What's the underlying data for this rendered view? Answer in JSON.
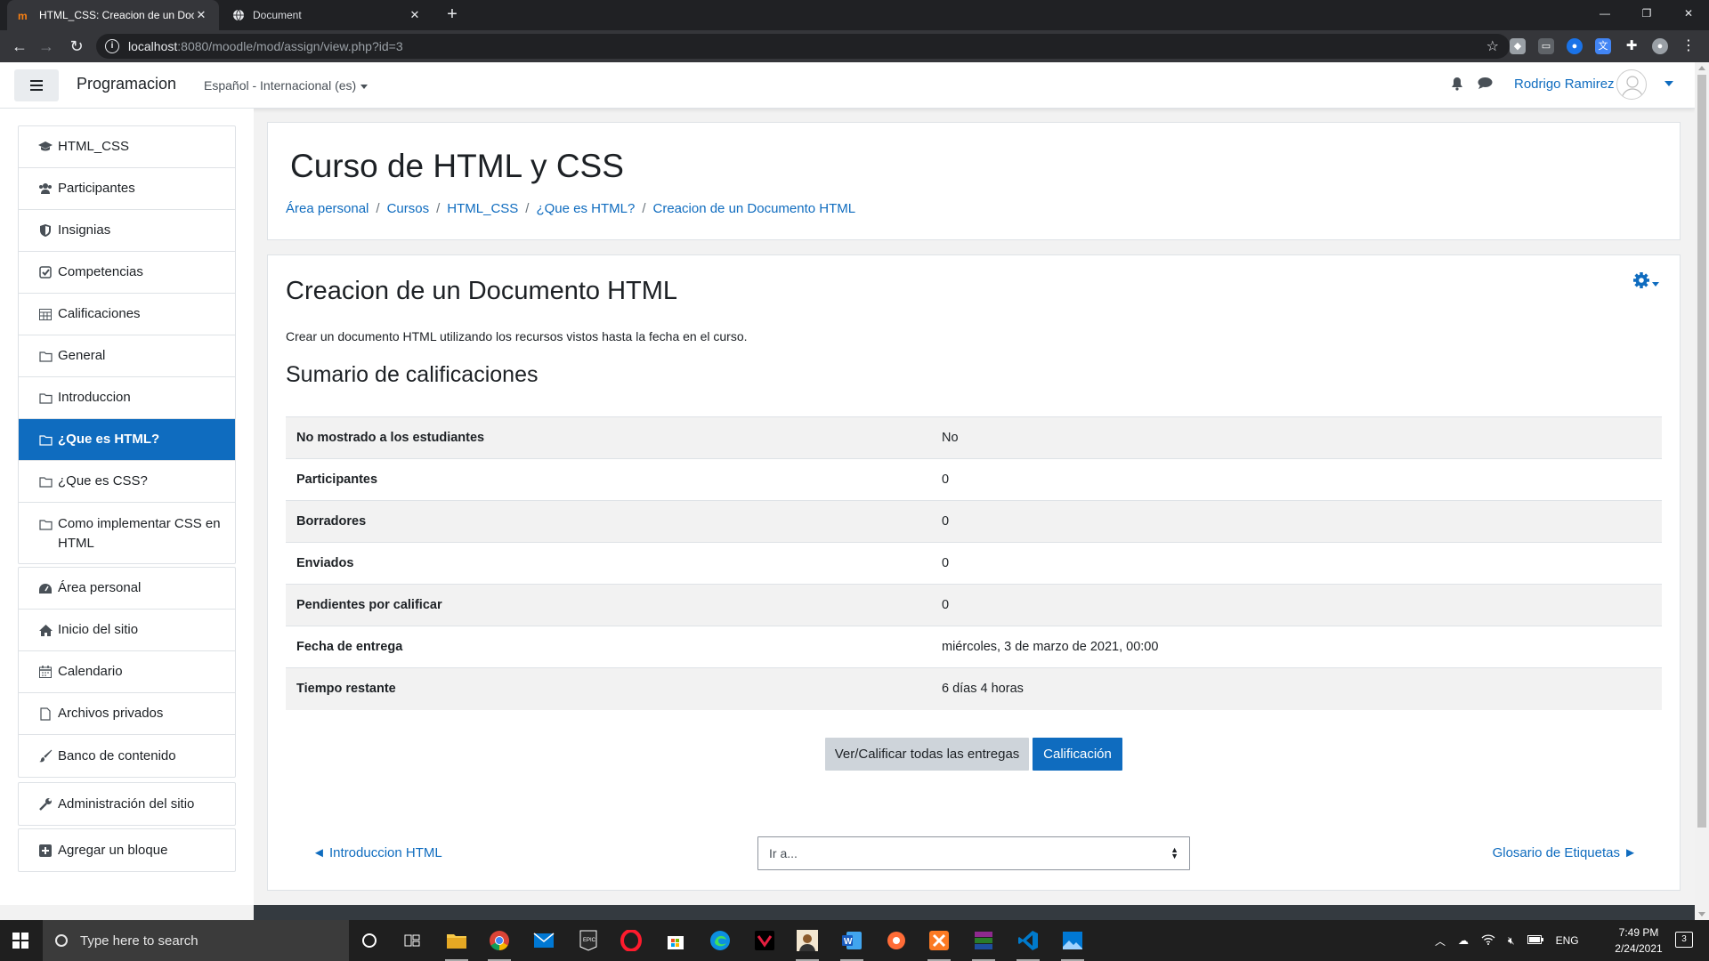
{
  "browser": {
    "tabs": [
      {
        "title": "HTML_CSS: Creacion de un Docu",
        "active": true
      },
      {
        "title": "Document",
        "active": false
      }
    ],
    "url_host": "localhost",
    "url_path": ":8080/moodle/mod/assign/view.php?id=3"
  },
  "navbar": {
    "site_name": "Programacion",
    "language": "Español - Internacional (es)",
    "user_name": "Rodrigo Ramirez"
  },
  "drawer": {
    "course_items": [
      {
        "label": "HTML_CSS",
        "icon": "graduation-cap-icon"
      },
      {
        "label": "Participantes",
        "icon": "users-icon"
      },
      {
        "label": "Insignias",
        "icon": "shield-icon"
      },
      {
        "label": "Competencias",
        "icon": "check-square-icon"
      },
      {
        "label": "Calificaciones",
        "icon": "table-icon"
      },
      {
        "label": "General",
        "icon": "folder-icon"
      },
      {
        "label": "Introduccion",
        "icon": "folder-icon"
      },
      {
        "label": "¿Que es HTML?",
        "icon": "folder-icon",
        "active": true
      },
      {
        "label": "¿Que es CSS?",
        "icon": "folder-icon"
      },
      {
        "label": "Como implementar CSS en HTML",
        "icon": "folder-icon"
      }
    ],
    "site_items": [
      {
        "label": "Área personal",
        "icon": "dashboard-icon"
      },
      {
        "label": "Inicio del sitio",
        "icon": "home-icon"
      },
      {
        "label": "Calendario",
        "icon": "calendar-icon"
      },
      {
        "label": "Archivos privados",
        "icon": "file-icon"
      },
      {
        "label": "Banco de contenido",
        "icon": "paintbrush-icon"
      }
    ],
    "admin_item": {
      "label": "Administración del sitio",
      "icon": "wrench-icon"
    },
    "block_item": {
      "label": "Agregar un bloque",
      "icon": "plus-square-icon"
    }
  },
  "header": {
    "course_title": "Curso de HTML y CSS",
    "breadcrumb": [
      "Área personal",
      "Cursos",
      "HTML_CSS",
      "¿Que es HTML?",
      "Creacion de un Documento HTML"
    ]
  },
  "main": {
    "activity_title": "Creacion de un Documento HTML",
    "intro": "Crear un documento HTML utilizando los recursos vistos hasta la fecha en el curso.",
    "summary_title": "Sumario de calificaciones",
    "summary_rows": [
      {
        "key": "No mostrado a los estudiantes",
        "value": "No"
      },
      {
        "key": "Participantes",
        "value": "0"
      },
      {
        "key": "Borradores",
        "value": "0"
      },
      {
        "key": "Enviados",
        "value": "0"
      },
      {
        "key": "Pendientes por calificar",
        "value": "0"
      },
      {
        "key": "Fecha de entrega",
        "value": "miércoles, 3 de marzo de 2021, 00:00"
      },
      {
        "key": "Tiempo restante",
        "value": "6 días 4 horas"
      }
    ],
    "view_all_button": "Ver/Calificar todas las entregas",
    "grade_button": "Calificación",
    "prev_link": "◄ Introduccion HTML",
    "next_link": "Glosario de Etiquetas ►",
    "jump_select": "Ir a..."
  },
  "taskbar": {
    "search_placeholder": "Type here to search",
    "lang": "ENG",
    "time": "7:49 PM",
    "date": "2/24/2021",
    "notifications": "3"
  },
  "colors": {
    "accent": "#0f6cbf",
    "chrome_dark": "#202124",
    "chrome_bar": "#35363a"
  }
}
